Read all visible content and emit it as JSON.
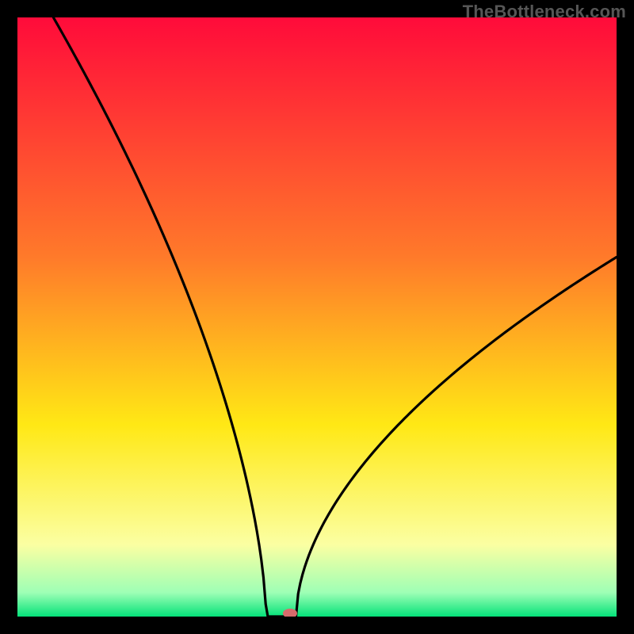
{
  "watermark": "TheBottleneck.com",
  "gradient_stops": [
    {
      "offset": "0%",
      "color": "#ff0b3a"
    },
    {
      "offset": "40%",
      "color": "#ff7a2a"
    },
    {
      "offset": "68%",
      "color": "#ffe815"
    },
    {
      "offset": "88%",
      "color": "#fbffa2"
    },
    {
      "offset": "96%",
      "color": "#9effb5"
    },
    {
      "offset": "100%",
      "color": "#05e27a"
    }
  ],
  "chart_data": {
    "type": "line",
    "title": "",
    "xlabel": "",
    "ylabel": "",
    "xlim": [
      0,
      100
    ],
    "ylim": [
      0,
      100
    ],
    "optimum_x": 44,
    "flat_halfwidth": 2.5,
    "left_start": {
      "x": 6,
      "y": 100
    },
    "right_end": {
      "x": 100,
      "y": 60
    },
    "left_shape": 0.62,
    "right_shape": 0.55,
    "marker": {
      "x": 45.5,
      "y": 0
    },
    "notes": "V-shaped bottleneck curve. y is bottleneck percentage (0 = optimal at bottom, 100 = worst at top). Curve reaches 0 in a small flat region around the optimum. Left side rises steeply to 100; right side rises more gently toward ~60."
  }
}
